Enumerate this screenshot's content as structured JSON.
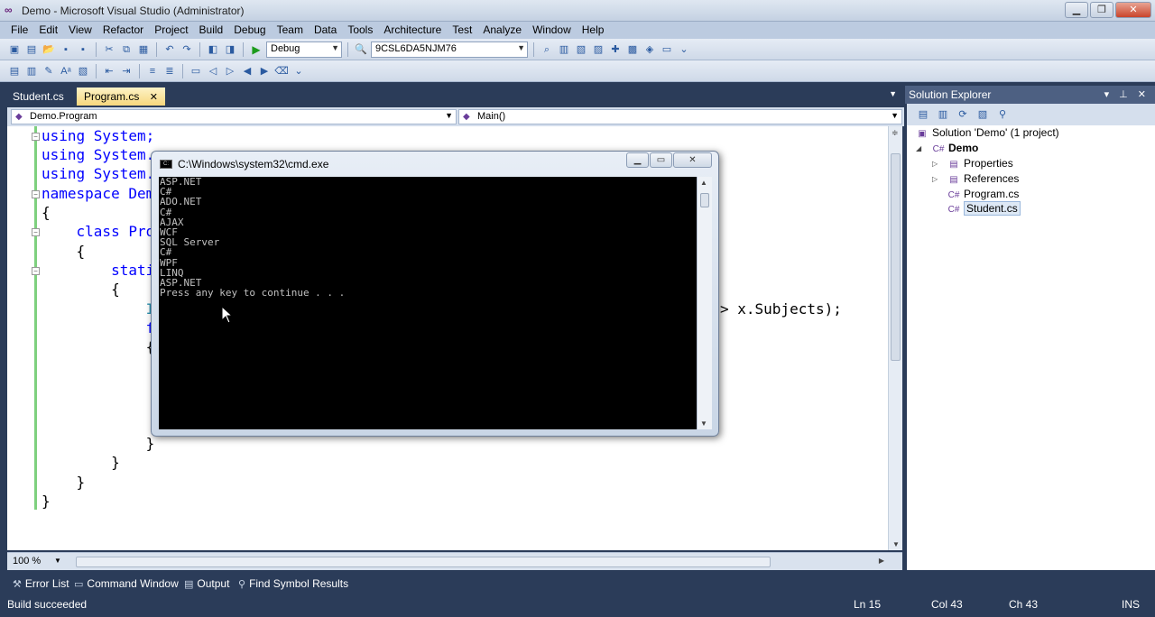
{
  "window": {
    "title": "Demo - Microsoft Visual Studio (Administrator)",
    "buttons": [
      "0",
      "1",
      "r"
    ]
  },
  "menu": [
    "File",
    "Edit",
    "View",
    "Refactor",
    "Project",
    "Build",
    "Debug",
    "Team",
    "Data",
    "Tools",
    "Architecture",
    "Test",
    "Analyze",
    "Window",
    "Help"
  ],
  "toolbar": {
    "config": "Debug",
    "platform": "9CSL6DA5NJM76"
  },
  "tabs": [
    {
      "label": "Student.cs",
      "active": false
    },
    {
      "label": "Program.cs",
      "active": true,
      "close": "✕"
    }
  ],
  "nav": {
    "type": "Demo.Program",
    "member": "Main()"
  },
  "code": [
    "using System;",
    "using System.",
    "using System.",
    "namespace Dem",
    "{",
    "    class Pro",
    "    {",
    "        stati",
    "        {",
    "            IE",
    "            fo",
    "            {",
    "            }",
    "        }",
    "    }",
    "}"
  ],
  "code_tail": "> x.Subjects);",
  "editor": {
    "zoom": "100 %"
  },
  "console": {
    "title": "C:\\Windows\\system32\\cmd.exe",
    "lines": [
      "ASP.NET",
      "C#",
      "ADO.NET",
      "C#",
      "AJAX",
      "WCF",
      "SQL Server",
      "C#",
      "WPF",
      "LINQ",
      "ASP.NET",
      "Press any key to continue . . ."
    ]
  },
  "solution": {
    "header": "Solution Explorer",
    "root": "Solution 'Demo' (1 project)",
    "project": "Demo",
    "items": [
      "Properties",
      "References",
      "Program.cs",
      "Student.cs"
    ]
  },
  "bottom_tabs": [
    "Error List",
    "Command Window",
    "Output",
    "Find Symbol Results"
  ],
  "status": {
    "message": "Build succeeded",
    "ln": "Ln 15",
    "col": "Col 43",
    "ch": "Ch 43",
    "mode": "INS"
  }
}
